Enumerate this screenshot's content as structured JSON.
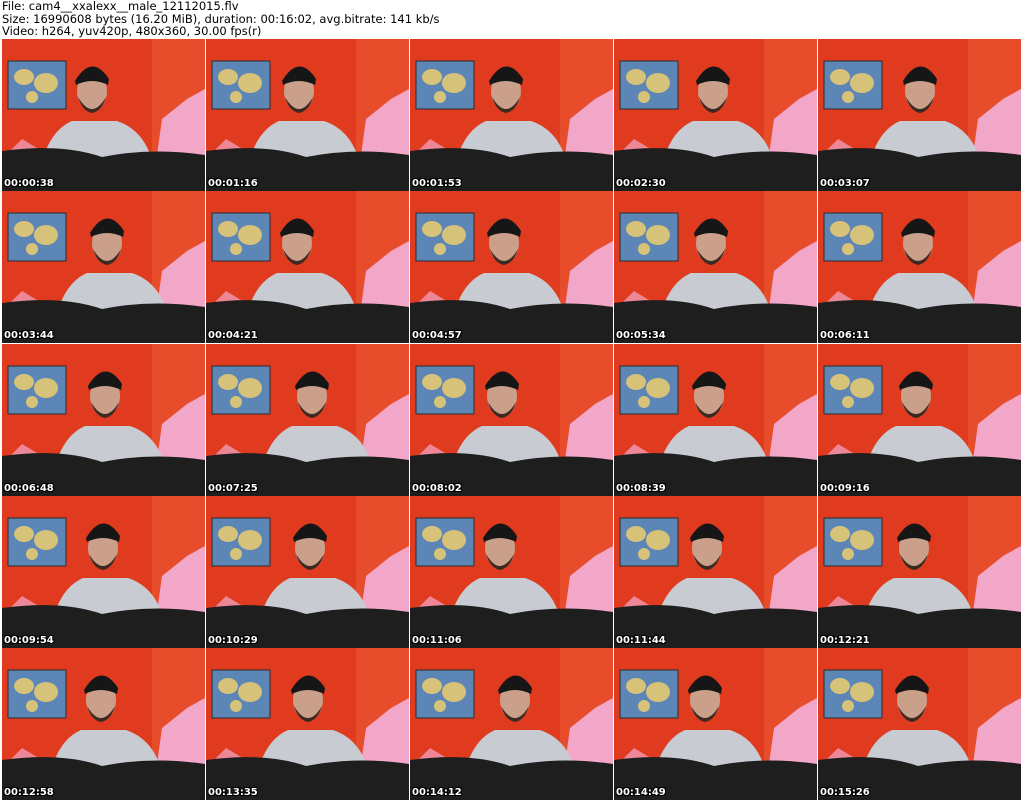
{
  "header": {
    "file_line": "File: cam4__xxalexx__male_12112015.flv",
    "size_line": "Size: 16990608 bytes (16.20 MiB), duration: 00:16:02, avg.bitrate: 141 kb/s",
    "video_line": "Video: h264, yuv420p, 480x360, 30.00 fps(r)"
  },
  "colors": {
    "wall": "#e03a1f",
    "pillow": "#f2a6c8",
    "shirt": "#c8ccd2",
    "pants": "#1e1e1e",
    "skin": "#caa08a",
    "hat": "#161616",
    "map_ocean": "#5b86b5",
    "map_land": "#d7c27a"
  },
  "thumbnails": [
    {
      "time": "00:00:38"
    },
    {
      "time": "00:01:16"
    },
    {
      "time": "00:01:53"
    },
    {
      "time": "00:02:30"
    },
    {
      "time": "00:03:07"
    },
    {
      "time": "00:03:44"
    },
    {
      "time": "00:04:21"
    },
    {
      "time": "00:04:57"
    },
    {
      "time": "00:05:34"
    },
    {
      "time": "00:06:11"
    },
    {
      "time": "00:06:48"
    },
    {
      "time": "00:07:25"
    },
    {
      "time": "00:08:02"
    },
    {
      "time": "00:08:39"
    },
    {
      "time": "00:09:16"
    },
    {
      "time": "00:09:54"
    },
    {
      "time": "00:10:29"
    },
    {
      "time": "00:11:06"
    },
    {
      "time": "00:11:44"
    },
    {
      "time": "00:12:21"
    },
    {
      "time": "00:12:58"
    },
    {
      "time": "00:13:35"
    },
    {
      "time": "00:14:12"
    },
    {
      "time": "00:14:49"
    },
    {
      "time": "00:15:26"
    }
  ]
}
